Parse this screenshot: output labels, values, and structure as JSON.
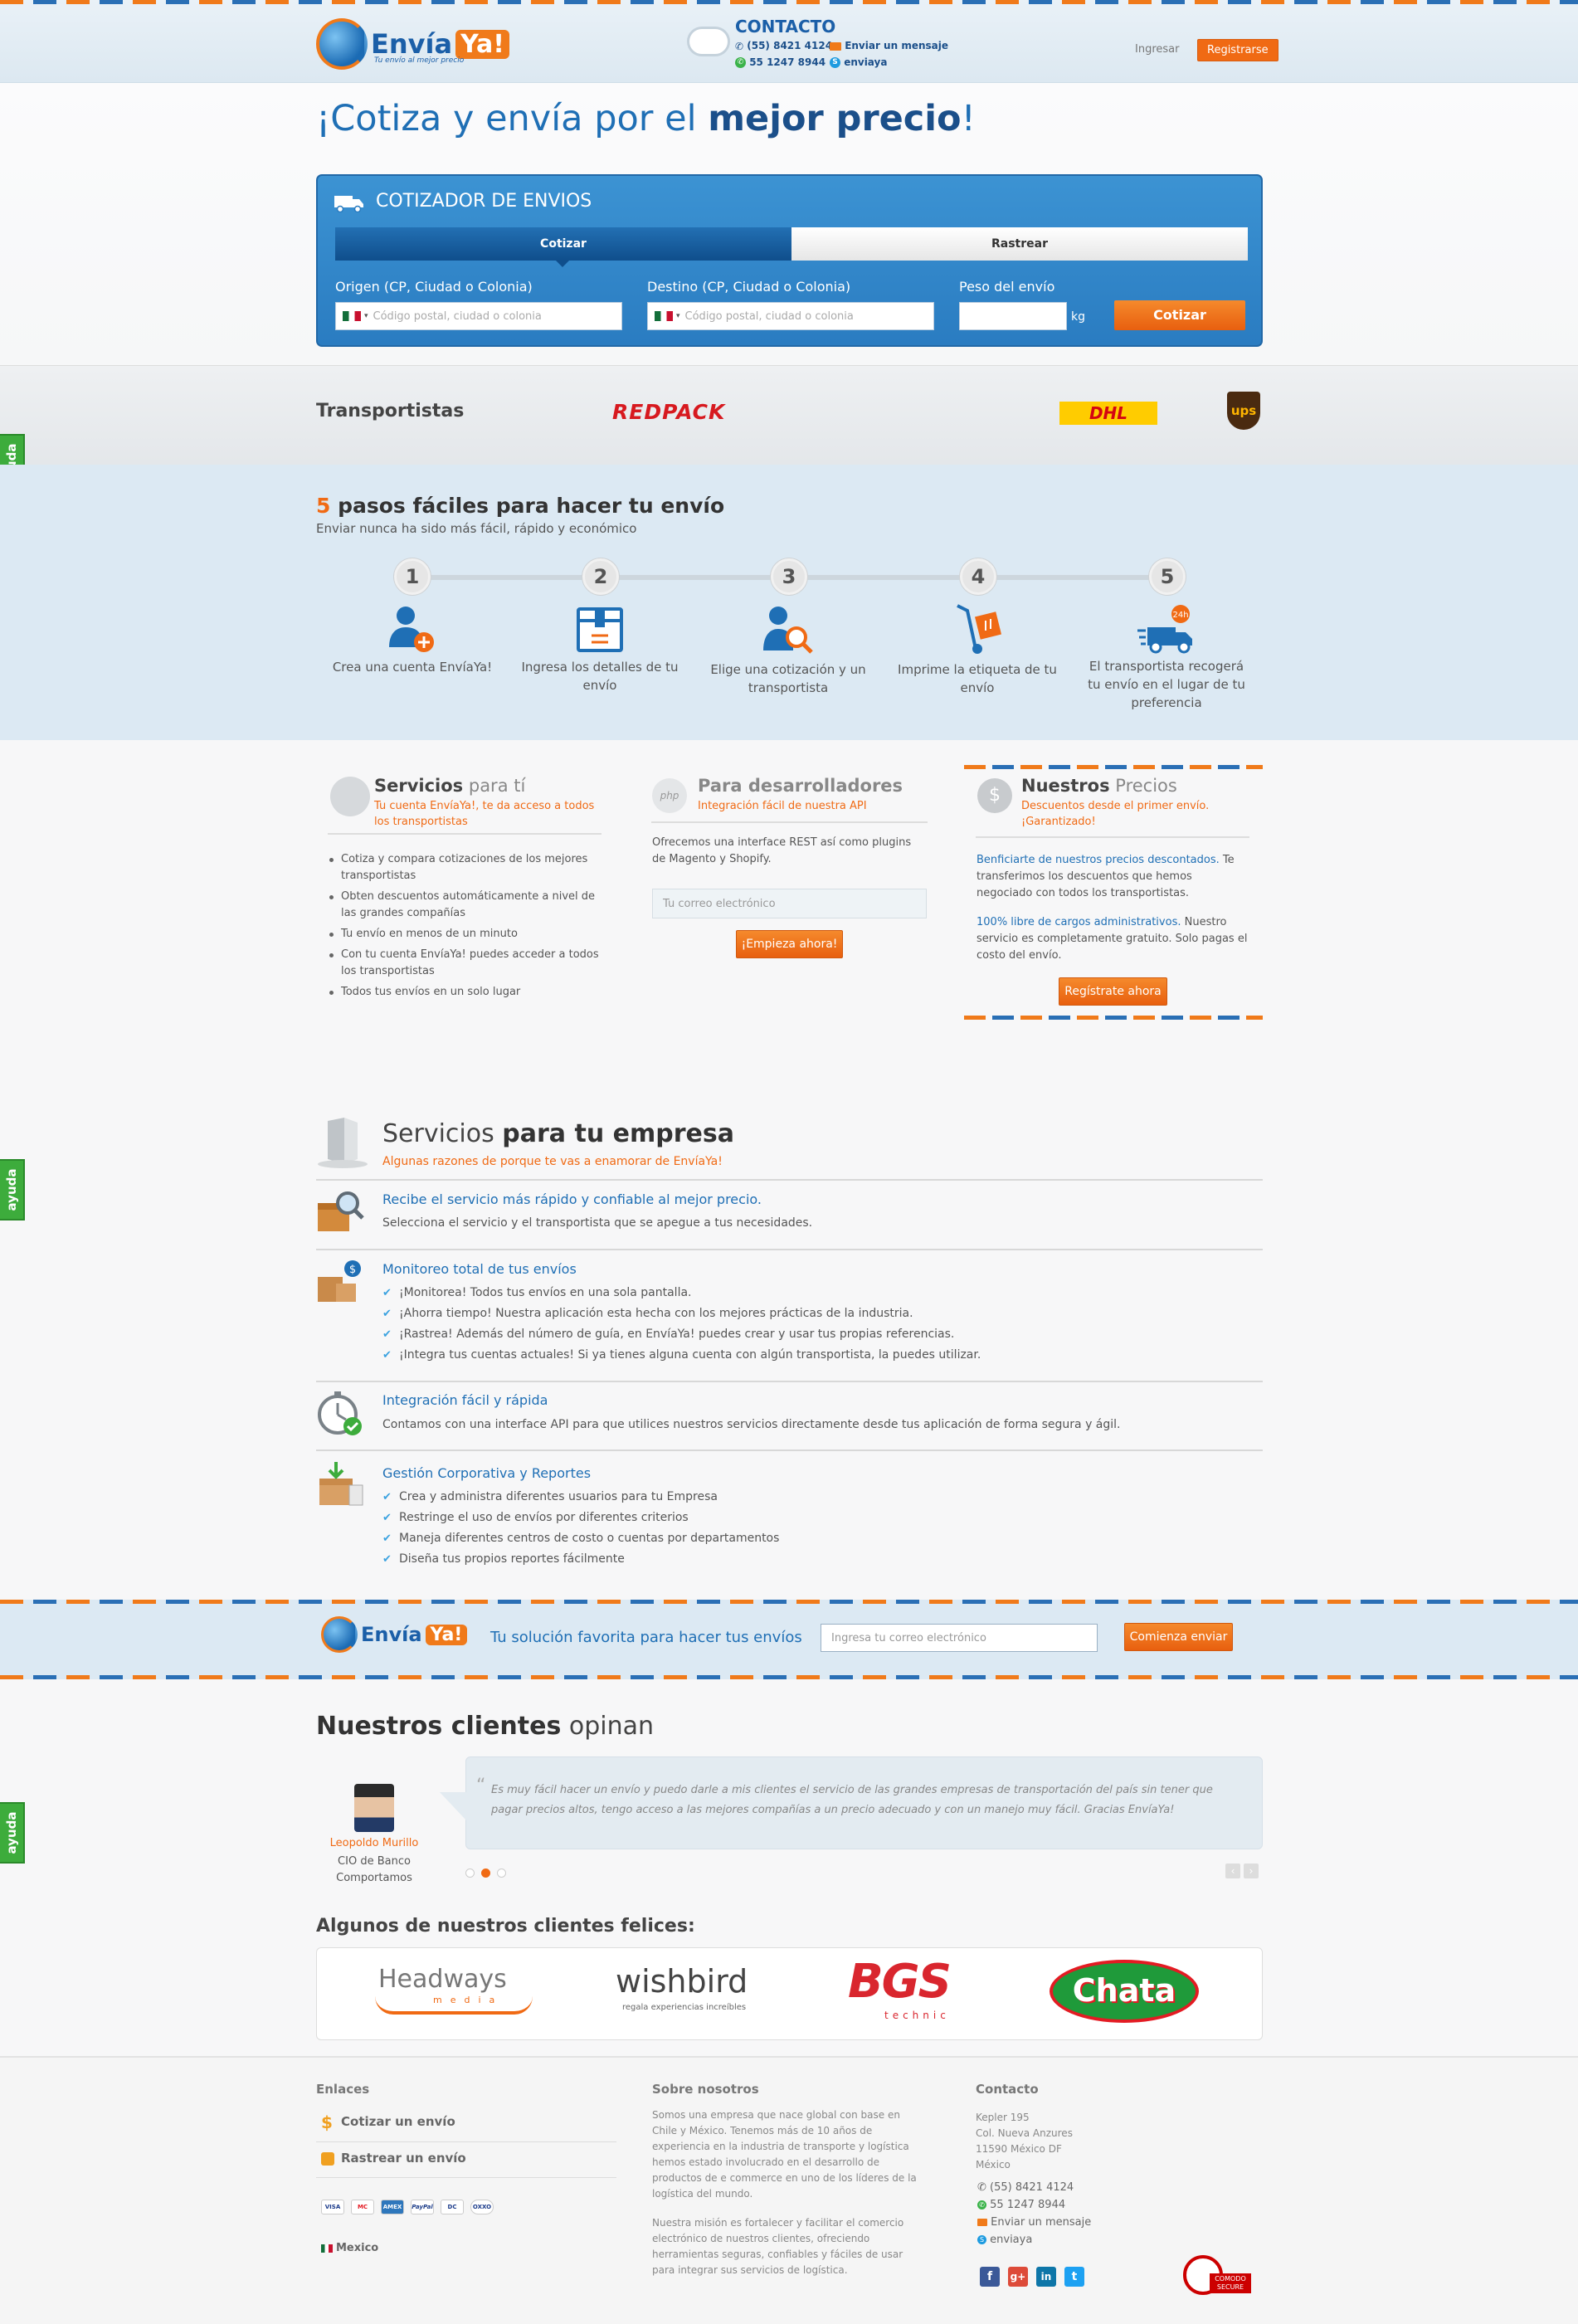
{
  "header": {
    "logo_text": "Envía",
    "logo_ya": "Ya!",
    "logo_tagline": "Tu envío al mejor precio",
    "contact_title": "CONTACTO",
    "phone": "(55) 8421 4124",
    "whatsapp": "55 1247 8944",
    "email_label": "Enviar un mensaje",
    "skype": "enviaya",
    "login": "Ingresar",
    "register": "Registrarse"
  },
  "hero": {
    "title_pre": "¡Cotiza y envía por el ",
    "title_bold": "mejor precio",
    "title_post": "!"
  },
  "quote": {
    "title": "COTIZADOR DE ENVIOS",
    "tab_cotizar": "Cotizar",
    "tab_rastrear": "Rastrear",
    "origin_label": "Origen (CP, Ciudad o Colonia)",
    "origin_placeholder": "Código postal, ciudad o colonia",
    "dest_label": "Destino (CP, Ciudad o Colonia)",
    "dest_placeholder": "Código postal, ciudad o colonia",
    "weight_label": "Peso del envío",
    "weight_unit": "kg",
    "button": "Cotizar"
  },
  "carriers": {
    "title": "Transportistas",
    "items": [
      "REDPACK",
      "DHL",
      "ups"
    ]
  },
  "steps": {
    "title_num": "5",
    "title_rest": " pasos fáciles para hacer tu envío",
    "subtitle": "Enviar nunca ha sido más fácil, rápido y económico",
    "items": [
      {
        "num": "1",
        "text": "Crea una cuenta EnvíaYa!"
      },
      {
        "num": "2",
        "text": "Ingresa los detalles de tu envío"
      },
      {
        "num": "3",
        "text": "Elige una cotización y un transportista"
      },
      {
        "num": "4",
        "text": "Imprime la etiqueta de tu envío"
      },
      {
        "num": "5",
        "text": "El transportista recogerá tu envío en el lugar de tu preferencia"
      }
    ],
    "badge_24": "24h"
  },
  "ayuda": "ayuda",
  "servicios": {
    "title_bold": "Servicios",
    "title_light": " para tí",
    "subtitle": "Tu cuenta EnvíaYa!, te da acceso a todos los transportistas",
    "bullets": [
      "Cotiza y compara cotizaciones de los mejores transportistas",
      "Obten descuentos automáticamente a nivel de las grandes compañías",
      "Tu envío en menos de un minuto",
      "Con tu cuenta EnvíaYa! puedes acceder a todos los transportistas",
      "Todos tus envíos en un solo lugar"
    ]
  },
  "dev": {
    "title_light": "Para",
    "title_bold": " desarrolladores",
    "subtitle": "Integración fácil de nuestra API",
    "text": "Ofrecemos una interface REST así como plugins de Magento y Shopify.",
    "email_placeholder": "Tu correo electrónico",
    "button": "¡Empieza ahora!",
    "php": "php"
  },
  "precios": {
    "title_bold": "Nuestros",
    "title_light": " Precios",
    "subtitle": "Descuentos desde el primer envío. ¡Garantizado!",
    "p1_link": "Benficiarte de nuestros precios descontados.",
    "p1_text": " Te transferimos los descuentos que hemos negociado con todos los transportistas.",
    "p2_link": "100% libre de cargos administrativos.",
    "p2_text": " Nuestro servicio es completamente gratuito. Solo pagas el costo del envío.",
    "button": "Regístrate ahora"
  },
  "empresa": {
    "title_light": "Servicios ",
    "title_bold": "para tu empresa",
    "subtitle": "Algunas razones de porque te vas a enamorar de EnvíaYa!",
    "s1_title": "Recibe el servicio más rápido y confiable al mejor precio.",
    "s1_text": "Selecciona el servicio y el transportista que se apegue a tus necesidades.",
    "s2_title": "Monitoreo total de tus envíos",
    "s2_items": [
      "¡Monitorea! Todos tus envíos en una sola pantalla.",
      "¡Ahorra tiempo! Nuestra aplicación esta hecha con los mejores prácticas de la industria.",
      "¡Rastrea! Además del número de guía, en EnvíaYa! puedes crear y usar tus propias referencias.",
      "¡Integra tus cuentas actuales! Si ya tienes alguna cuenta con algún transportista, la puedes utilizar."
    ],
    "s3_title": "Integración fácil y rápida",
    "s3_text": "Contamos con una interface API para que utilices nuestros servicios directamente desde tus aplicación de forma segura y ágil.",
    "s4_title": "Gestión Corporativa y Reportes",
    "s4_items": [
      "Crea y administra diferentes usuarios para tu Empresa",
      "Restringe el uso de envíos por diferentes criterios",
      "Maneja diferentes centros de costo o cuentas por departamentos",
      "Diseña tus propios reportes fácilmente"
    ]
  },
  "cta": {
    "text": "Tu solución favorita para hacer tus envíos",
    "placeholder": "Ingresa tu correo electrónico",
    "button": "Comienza enviar"
  },
  "testimonials": {
    "title_bold": "Nuestros clientes",
    "title_light": " opinan",
    "quote": "Es muy fácil hacer un envío y puedo darle a mis clientes el servicio de las grandes empresas de transportación del país sin tener que pagar precios altos, tengo acceso a las mejores compañías a un precio adecuado y con un manejo muy fácil. Gracias EnvíaYa!",
    "name": "Leopoldo Murillo",
    "role": "CIO de Banco Comportamos"
  },
  "happy": {
    "title": "Algunos de nuestros clientes felices:",
    "logos": [
      "Headways",
      "media",
      "wishbird",
      "regala experiencias increíbles",
      "BGS",
      "technic",
      "Chata"
    ]
  },
  "footer": {
    "enlaces_title": "Enlaces",
    "link1": "Cotizar un envío",
    "link2": "Rastrear un envío",
    "cards": [
      "VISA",
      "MC",
      "AMEX",
      "PayPal",
      "DC",
      "OXXO"
    ],
    "country": "Mexico",
    "about_title": "Sobre nosotros",
    "about_p1": "Somos una empresa que nace global con base en Chile y México. Tenemos más de 10 años de experiencia en la industria de transporte y logística hemos estado involucrado en el desarrollo de productos de e commerce en uno de los líderes de la logística del mundo.",
    "about_p2": "Nuestra misión es fortalecer y facilitar el comercio electrónico de nuestros clientes, ofreciendo herramientas seguras, confiables y fáciles de usar para integrar sus servicios de logística.",
    "contact_title": "Contacto",
    "address1": "Kepler 195",
    "address2": "Col. Nueva Anzures",
    "address3": "11590 México DF",
    "address4": "México",
    "phone": "(55) 8421 4124",
    "whatsapp": "55  1247 8944",
    "email": "Enviar un mensaje",
    "skype": "enviaya",
    "comodo": "COMODO SECURE"
  },
  "colors": {
    "primary": "#1f6fb5",
    "accent": "#f06a14",
    "help": "#3dac3c"
  }
}
